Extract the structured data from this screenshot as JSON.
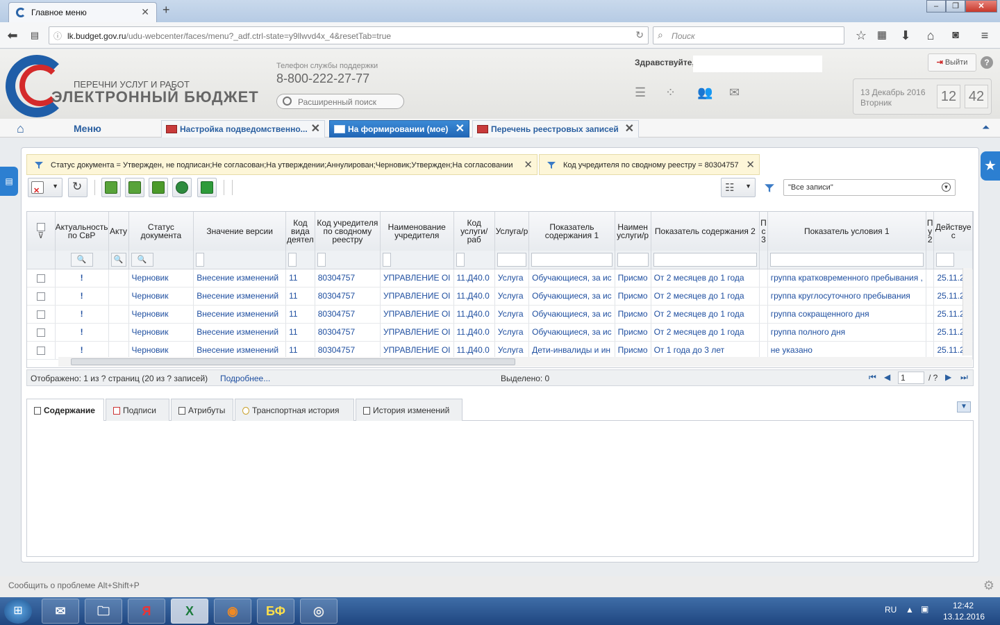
{
  "browser": {
    "tab_title": "Главное меню",
    "new_tab": "+",
    "url_host": "lk.budget.gov.ru",
    "url_path": "/udu-webcenter/faces/menu?_adf.ctrl-state=y9llwvd4x_4&resetTab=true",
    "search_placeholder": "Поиск",
    "window_controls": [
      "–",
      "❐",
      "✕"
    ]
  },
  "header": {
    "brand_line1": "ПЕРЕЧНИ УСЛУГ И РАБОТ",
    "brand_line2": "ЭЛЕКТРОННЫЙ БЮДЖЕТ",
    "phone_label": "Телефон службы поддержки",
    "phone": "8-800-222-27-77",
    "advanced_search": "Расширенный поиск",
    "greeting": "Здравствуйте,",
    "logout": "Выйти",
    "help": "?",
    "date": "13 Декабрь 2016",
    "weekday": "Вторник",
    "hour": "12",
    "minute": "42"
  },
  "tabs": {
    "menu": "Меню",
    "items": [
      {
        "label": "Настройка подведомственно..."
      },
      {
        "label": "На формировании (мое)"
      },
      {
        "label": "Перечень реестровых записей"
      }
    ]
  },
  "filters": [
    "Статус документа = Утвержден, не подписан;Не согласован;На утверждении;Аннулирован;Черновик;Утвержден;На согласовании",
    "Код учредителя по сводному реестру = 80304757"
  ],
  "toolbar": {
    "record_filter": "\"Все записи\""
  },
  "grid": {
    "columns": [
      "Актуальность по СвР",
      "Акту",
      "Статус документа",
      "Значение версии",
      "Код вида деятел",
      "Код учредителя по сводному реестру",
      "Наименование учредителя",
      "Код услуги/раб",
      "Услуга/р",
      "Показатель содержания 1",
      "Наимен услуги/р",
      "Показатель содержания 2",
      "П с 3",
      "Показатель условия 1",
      "П у 2",
      "Действуе с"
    ],
    "rows": [
      [
        "!",
        "",
        "Черновик",
        "Внесение изменений",
        "11",
        "80304757",
        "УПРАВЛЕНИЕ ОІ",
        "11.Д40.0",
        "Услуга",
        "Обучающиеся, за ис",
        "Присмо",
        "От 2 месяцев до 1 года",
        "",
        "группа кратковременного пребывания ,",
        "",
        "25.11.2"
      ],
      [
        "!",
        "",
        "Черновик",
        "Внесение изменений",
        "11",
        "80304757",
        "УПРАВЛЕНИЕ ОІ",
        "11.Д40.0",
        "Услуга",
        "Обучающиеся, за ис",
        "Присмо",
        "От 2 месяцев до 1 года",
        "",
        "группа круглосуточного пребывания",
        "",
        "25.11.2"
      ],
      [
        "!",
        "",
        "Черновик",
        "Внесение изменений",
        "11",
        "80304757",
        "УПРАВЛЕНИЕ ОІ",
        "11.Д40.0",
        "Услуга",
        "Обучающиеся, за ис",
        "Присмо",
        "От 2 месяцев до 1 года",
        "",
        "группа сокращенного дня",
        "",
        "25.11.2"
      ],
      [
        "!",
        "",
        "Черновик",
        "Внесение изменений",
        "11",
        "80304757",
        "УПРАВЛЕНИЕ ОІ",
        "11.Д40.0",
        "Услуга",
        "Обучающиеся, за ис",
        "Присмо",
        "От 2 месяцев до 1 года",
        "",
        "группа полного дня",
        "",
        "25.11.2"
      ],
      [
        "!",
        "",
        "Черновик",
        "Внесение изменений",
        "11",
        "80304757",
        "УПРАВЛЕНИЕ ОІ",
        "11.Д40.0",
        "Услуга",
        "Дети-инвалиды и ин",
        "Присмо",
        "От 1 года до 3 лет",
        "",
        "не указано",
        "",
        "25.11.2"
      ]
    ]
  },
  "status": {
    "shown": "Отображено: 1 из ? страниц (20 из ? записей)",
    "more": "Подробнее...",
    "selected": "Выделено: 0",
    "page": "1",
    "page_total": "/ ?"
  },
  "detail_tabs": [
    "Содержание",
    "Подписи",
    "Атрибуты",
    "Транспортная история",
    "История изменений"
  ],
  "footer": {
    "report": "Сообщить о проблеме Alt+Shift+P"
  },
  "taskbar": {
    "lang": "RU",
    "time": "12:42",
    "date": "13.12.2016",
    "apps": [
      "✉",
      "🗀",
      "Я",
      "X",
      "◉",
      "БФ",
      "◎"
    ]
  }
}
